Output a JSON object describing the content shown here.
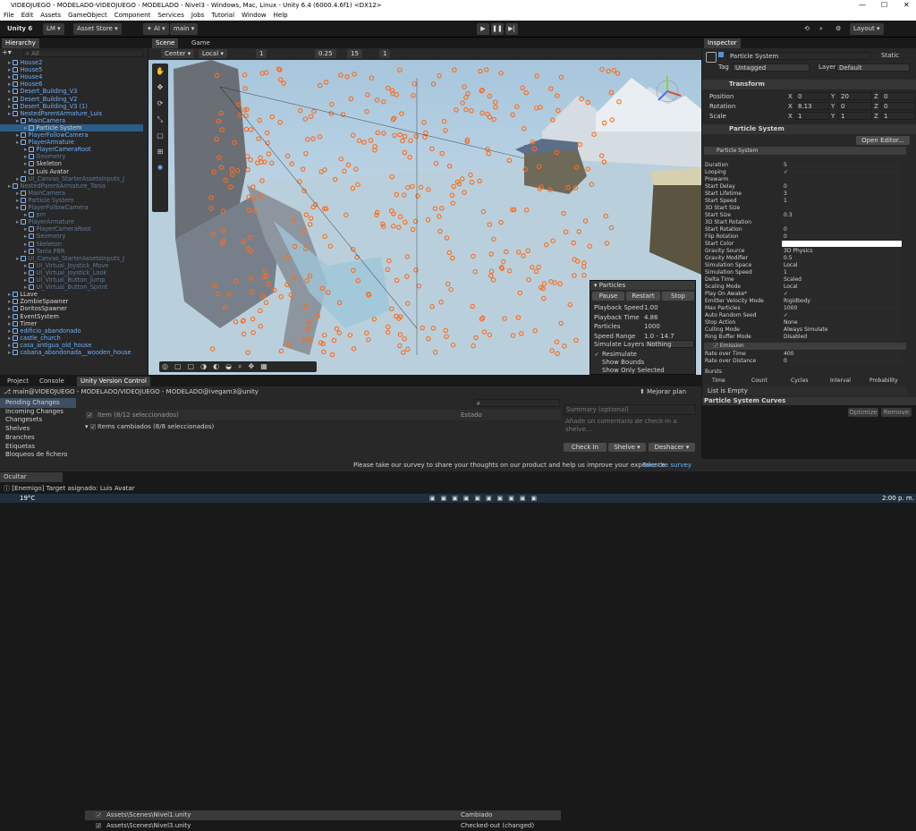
{
  "window": {
    "title": "VIDEOJUEGO - MODELADO-VIDEOJUEGO - MODELADO - Nivel3 - Windows, Mac, Linux - Unity 6.4 (6000.4.6f1) <DX12>",
    "min": "—",
    "max": "☐",
    "close": "✕"
  },
  "menu": [
    "File",
    "Edit",
    "Assets",
    "GameObject",
    "Component",
    "Services",
    "Jobs",
    "Tutorial",
    "Window",
    "Help"
  ],
  "toolbar": {
    "unity": "Unity 6",
    "account": "LM ▾",
    "asset_store": "Asset Store ▾",
    "ai": "✦ AI ▾",
    "branch": "main ▾",
    "layout": "Layout ▾"
  },
  "hierarchy": {
    "tab": "Hierarchy",
    "search_placeholder": "All",
    "items": [
      {
        "label": "House2",
        "style": "blue",
        "indent": 1
      },
      {
        "label": "House5",
        "style": "blue",
        "indent": 1
      },
      {
        "label": "House4",
        "style": "blue",
        "indent": 1
      },
      {
        "label": "House6",
        "style": "blue",
        "indent": 1
      },
      {
        "label": "Desert_Building_V3",
        "style": "blue",
        "indent": 1
      },
      {
        "label": "Desert_Building_V2",
        "style": "blue",
        "indent": 1
      },
      {
        "label": "Desert_Building_V3 (1)",
        "style": "blue",
        "indent": 1
      },
      {
        "label": "NestedParentArmature_Luis",
        "style": "blue",
        "indent": 1
      },
      {
        "label": "MainCamera",
        "style": "blue",
        "indent": 2
      },
      {
        "label": "Particle System",
        "style": "sel",
        "indent": 3
      },
      {
        "label": "PlayerFollowCamera",
        "style": "blue",
        "indent": 2
      },
      {
        "label": "PlayerArmature",
        "style": "blue",
        "indent": 2
      },
      {
        "label": "PlayerCameraRoot",
        "style": "blue",
        "indent": 3
      },
      {
        "label": "Geometry",
        "style": "grey",
        "indent": 3
      },
      {
        "label": "Skeleton",
        "style": "white",
        "indent": 3
      },
      {
        "label": "Luis Avatar",
        "style": "white",
        "indent": 3
      },
      {
        "label": "UI_Canvas_StarterAssetsInputs_J",
        "style": "grey",
        "indent": 2
      },
      {
        "label": "NestedParentArmature_Tania",
        "style": "grey",
        "indent": 1
      },
      {
        "label": "MainCamera",
        "style": "grey",
        "indent": 2
      },
      {
        "label": "Particle System",
        "style": "grey",
        "indent": 2
      },
      {
        "label": "PlayerFollowCamera",
        "style": "grey",
        "indent": 2
      },
      {
        "label": "pm",
        "style": "grey",
        "indent": 3
      },
      {
        "label": "PlayerArmature",
        "style": "grey",
        "indent": 2
      },
      {
        "label": "PlayerCameraRoot",
        "style": "grey",
        "indent": 3
      },
      {
        "label": "Geometry",
        "style": "grey",
        "indent": 3
      },
      {
        "label": "Skeleton",
        "style": "grey",
        "indent": 3
      },
      {
        "label": "Tania PBR",
        "style": "grey",
        "indent": 3
      },
      {
        "label": "UI_Canvas_StarterAssetsInputs_J",
        "style": "grey",
        "indent": 2
      },
      {
        "label": "UI_Virtual_Joystick_Move",
        "style": "grey",
        "indent": 3
      },
      {
        "label": "UI_Virtual_Joystick_Look",
        "style": "grey",
        "indent": 3
      },
      {
        "label": "UI_Virtual_Button_Jump",
        "style": "grey",
        "indent": 3
      },
      {
        "label": "UI_Virtual_Button_Sprint",
        "style": "grey",
        "indent": 3
      },
      {
        "label": "LLave",
        "style": "white",
        "indent": 1
      },
      {
        "label": "ZombieSpawner",
        "style": "white",
        "indent": 1
      },
      {
        "label": "DoritosSpawner",
        "style": "white",
        "indent": 1
      },
      {
        "label": "EventSystem",
        "style": "white",
        "indent": 1
      },
      {
        "label": "Timer",
        "style": "white",
        "indent": 1
      },
      {
        "label": "edificio_abandonado",
        "style": "blue",
        "indent": 1
      },
      {
        "label": "castle_church",
        "style": "blue",
        "indent": 1
      },
      {
        "label": "casa_antigua_old_house",
        "style": "blue",
        "indent": 1
      },
      {
        "label": "cabana_abandonada__wooden_house",
        "style": "blue",
        "indent": 1
      }
    ]
  },
  "scene": {
    "tab_scene": "Scene",
    "tab_game": "Game",
    "pivot": "Center ▾",
    "space": "Local ▾",
    "grid": "1",
    "snap": "0.25",
    "angle": "15",
    "scale": "1"
  },
  "particles": {
    "title": "Particles",
    "pause": "Pause",
    "restart": "Restart",
    "stop": "Stop",
    "rows": [
      [
        "Playback Speed",
        "1.00"
      ],
      [
        "Playback Time",
        "4.86"
      ],
      [
        "Particles",
        "1000"
      ],
      [
        "Speed Range",
        "1.0 - 14.7"
      ]
    ],
    "simulate_label": "Simulate Layers",
    "simulate_value": "Nothing",
    "checks": [
      [
        "✓",
        "Resimulate"
      ],
      [
        "",
        "Show Bounds"
      ],
      [
        "",
        "Show Only Selected"
      ]
    ]
  },
  "inspector": {
    "tab": "Inspector",
    "name": "Particle System",
    "static": "Static",
    "tag_label": "Tag",
    "tag": "Untagged",
    "layer_label": "Layer",
    "layer": "Default",
    "transform": "Transform",
    "position": {
      "label": "Position",
      "x": "0",
      "y": "20",
      "z": "0"
    },
    "rotation": {
      "label": "Rotation",
      "x": "8.13",
      "y": "0",
      "z": "0"
    },
    "scale": {
      "label": "Scale",
      "x": "1",
      "y": "1",
      "z": "1"
    },
    "ps_header": "Particle System",
    "open_editor": "Open Editor...",
    "module": "Particle System",
    "props": [
      [
        "Duration",
        "5"
      ],
      [
        "Looping",
        "✓"
      ],
      [
        "Prewarm",
        ""
      ],
      [
        "Start Delay",
        "0"
      ],
      [
        "Start Lifetime",
        "3"
      ],
      [
        "Start Speed",
        "1"
      ],
      [
        "3D Start Size",
        ""
      ],
      [
        "Start Size",
        "0.3"
      ],
      [
        "3D Start Rotation",
        ""
      ],
      [
        "Start Rotation",
        "0"
      ],
      [
        "Flip Rotation",
        "0"
      ],
      [
        "Start Color",
        ""
      ],
      [
        "Gravity Source",
        "3D Physics"
      ],
      [
        "Gravity Modifier",
        "0.5"
      ],
      [
        "Simulation Space",
        "Local"
      ],
      [
        "Simulation Speed",
        "1"
      ],
      [
        "Delta Time",
        "Scaled"
      ],
      [
        "Scaling Mode",
        "Local"
      ],
      [
        "Play On Awake*",
        "✓"
      ],
      [
        "Emitter Velocity Mode",
        "Rigidbody"
      ],
      [
        "Max Particles",
        "1000"
      ],
      [
        "Auto Random Seed",
        "✓"
      ],
      [
        "Stop Action",
        "None"
      ],
      [
        "Culling Mode",
        "Always Simulate"
      ],
      [
        "Ring Buffer Mode",
        "Disabled"
      ]
    ],
    "emission": "Emission",
    "rate_time": {
      "label": "Rate over Time",
      "value": "400"
    },
    "rate_dist": {
      "label": "Rate over Distance",
      "value": "0"
    },
    "bursts": "Bursts",
    "burst_cols": [
      "Time",
      "Count",
      "Cycles",
      "Interval",
      "Probability"
    ],
    "list_empty": "List is Empty",
    "curves": "Particle System Curves",
    "optimize": "Optimize",
    "remove": "Remove"
  },
  "bottom": {
    "tabs": [
      "Project",
      "Console",
      "Unity Version Control"
    ],
    "path": "main@VIDEOJUEGO - MODELADO/VIDEOJUEGO - MODELADO@ivegam3@unity",
    "merge": "Mejorar plan",
    "side": [
      "Pending Changes",
      "Incoming Changes",
      "Changesets",
      "Shelves",
      "Branches",
      "Etiquetas",
      "Bloqueos de fichero"
    ],
    "header_item": "Item (8/12 seleccionados)",
    "header_state": "Estado",
    "group": "Items cambiados (8/8 seleccionados)",
    "files": [
      [
        "Assets\\Scenes\\Nivel1.unity",
        "Cambiado"
      ],
      [
        "Assets\\Scenes\\Nivel3.unity",
        "Checked-out (changed)"
      ]
    ],
    "summary_placeholder": "Summary (optional)",
    "comment_placeholder": "Añade un comentario de check-in a shelve...",
    "checkin": "Check In",
    "shelve": "Shelve ▾",
    "undo": "Deshacer ▾",
    "survey": "Please take our survey to share your thoughts on our product and help us improve your experience.",
    "survey_link": "Take the survey",
    "notification": "Ocultar Notificación"
  },
  "status": "[Enemigo] Target asignado: Luis Avatar",
  "taskbar": {
    "temp": "19°C",
    "time": "2:00 p. m."
  }
}
